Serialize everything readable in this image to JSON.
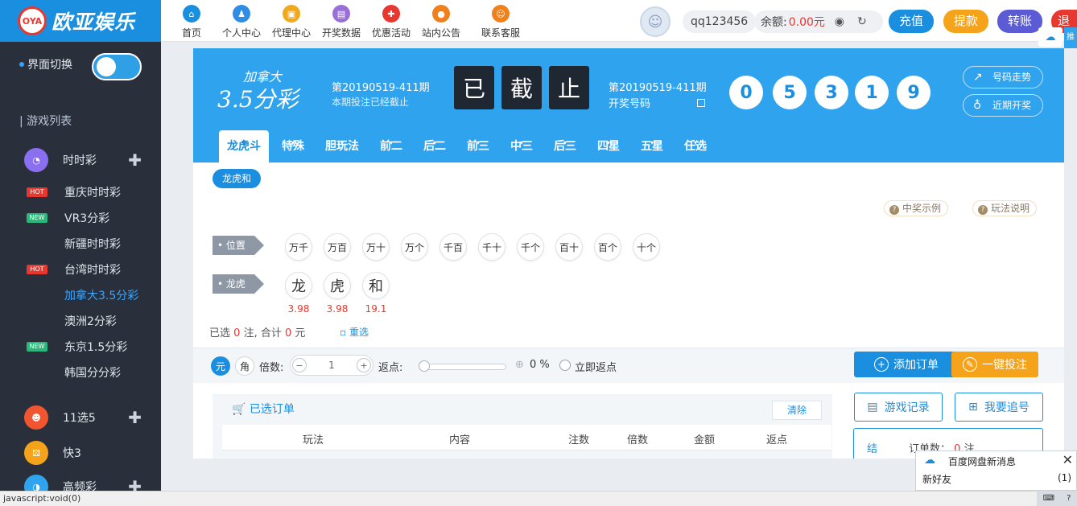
{
  "brand": {
    "logo_badge": "OYA",
    "name": "欧亚娱乐"
  },
  "nav": [
    {
      "label": "首页",
      "icon": "home-icon",
      "color": "#1a8fe0",
      "glyph": "⌂"
    },
    {
      "label": "个人中心",
      "icon": "user-icon",
      "color": "#2f8de4",
      "glyph": "♟"
    },
    {
      "label": "代理中心",
      "icon": "agent-icon",
      "color": "#f0a81c",
      "glyph": "▣"
    },
    {
      "label": "开奖数据",
      "icon": "data-icon",
      "color": "#9b6fd8",
      "glyph": "▤"
    },
    {
      "label": "优惠活动",
      "icon": "gift-icon",
      "color": "#e8372f",
      "glyph": "✚"
    },
    {
      "label": "站内公告",
      "icon": "notice-icon",
      "color": "#f0801c",
      "glyph": "●"
    },
    {
      "label": "联系客服",
      "icon": "service-icon",
      "color": "#f0801c",
      "glyph": "☺"
    }
  ],
  "user": {
    "username": "qq123456",
    "balance_label": "余额:",
    "balance_value": "0.00元"
  },
  "header_buttons": [
    {
      "label": "充值",
      "color": "#1a8fe0"
    },
    {
      "label": "提款",
      "color": "#f5a31a"
    },
    {
      "label": "转账",
      "color": "#5b5bd6"
    },
    {
      "label": "退出",
      "color": "#e8372f"
    }
  ],
  "sidebar": {
    "switch_label": "界面切换",
    "games_list_label": "游戏列表",
    "categories": [
      {
        "label": "时时彩",
        "icon": "ssc-icon",
        "color": "#8a6ff0"
      },
      {
        "label": "11选5",
        "icon": "11x5-icon",
        "color": "#f0552f"
      },
      {
        "label": "快3",
        "icon": "k3-icon",
        "color": "#f5a31a"
      },
      {
        "label": "高频彩",
        "icon": "gpc-icon",
        "color": "#2fa3ee"
      }
    ],
    "items": [
      {
        "label": "重庆时时彩",
        "tag": "HOT"
      },
      {
        "label": "VR3分彩",
        "tag": "NEW"
      },
      {
        "label": "新疆时时彩",
        "tag": ""
      },
      {
        "label": "台湾时时彩",
        "tag": "HOT"
      },
      {
        "label": "加拿大3.5分彩",
        "tag": ""
      },
      {
        "label": "澳洲2分彩",
        "tag": ""
      },
      {
        "label": "东京1.5分彩",
        "tag": "NEW"
      },
      {
        "label": "韩国分分彩",
        "tag": ""
      }
    ]
  },
  "lottery": {
    "name": "加拿大",
    "name_sub": "3.5分彩",
    "current_issue": "第20190519-411期",
    "current_tip": "本期投注已经截止",
    "stop_chars": [
      "已",
      "截",
      "止"
    ],
    "open_issue": "第20190519-411期",
    "open_label": "开奖号码",
    "balls": [
      "0",
      "5",
      "3",
      "1",
      "9"
    ],
    "trend_label": "号码走势",
    "recent_label": "近期开奖"
  },
  "tabs": [
    "龙虎斗",
    "特殊",
    "胆玩法",
    "前二",
    "后二",
    "前三",
    "中三",
    "后三",
    "四星",
    "五星",
    "任选"
  ],
  "subtab": "龙虎和",
  "help": {
    "example": "中奖示例",
    "rules": "玩法说明"
  },
  "positions_label": "位置",
  "positions": [
    "万千",
    "万百",
    "万十",
    "万个",
    "千百",
    "千十",
    "千个",
    "百十",
    "百个",
    "十个"
  ],
  "dragon_label": "龙虎",
  "dragon_options": [
    {
      "label": "龙",
      "odds": "3.98"
    },
    {
      "label": "虎",
      "odds": "3.98"
    },
    {
      "label": "和",
      "odds": "19.1"
    }
  ],
  "summary": {
    "prefix": "已选",
    "count": "0",
    "mid": "注, 合计",
    "amount": "0",
    "suffix": "元",
    "reset": "重选"
  },
  "controls": {
    "unit_yuan": "元",
    "unit_jiao": "角",
    "multiplier_label": "倍数:",
    "multiplier_value": "1",
    "rebate_label": "返点:",
    "rebate_percent": "0 %",
    "instant_rebate": "立即返点"
  },
  "actions": {
    "add_order": "添加订单",
    "one_click": "一键投注"
  },
  "orders": {
    "title": "已选订单",
    "clear": "清除",
    "columns": [
      "玩法",
      "内容",
      "注数",
      "倍数",
      "金额",
      "返点"
    ]
  },
  "side": {
    "game_records": "游戏记录",
    "chase": "我要追号",
    "jie": "结",
    "order_count_label": "订单数：",
    "order_count": "0",
    "order_count_unit": "注"
  },
  "notification": {
    "title": "百度网盘新消息",
    "message": "新好友",
    "count": "(1)"
  },
  "statusbar": {
    "text": "javascript:void(0)"
  },
  "edge_tab": "推"
}
